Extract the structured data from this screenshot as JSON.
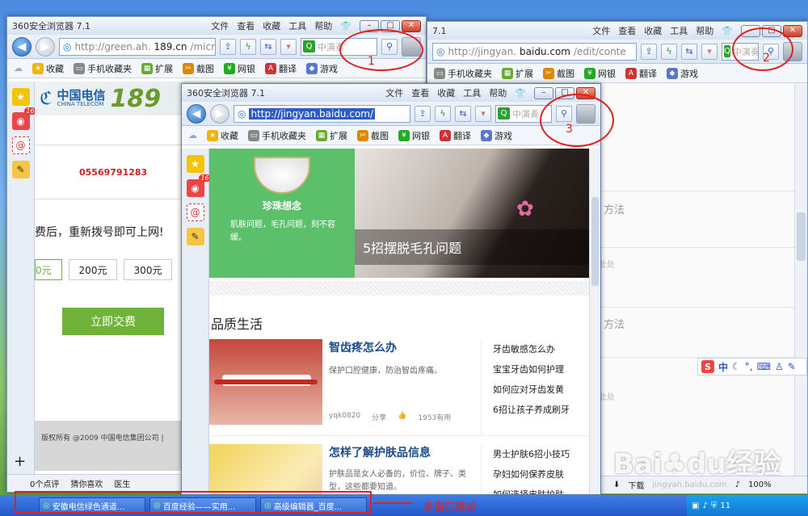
{
  "app_name": "360安全浏览器 7.1",
  "menu": [
    "文件",
    "查看",
    "收藏",
    "工具",
    "帮助"
  ],
  "window_back": {
    "url_prefix": "http://green.ah.",
    "url_domain": "189.cn",
    "url_suffix": "/micro/green",
    "search_placeholder": "中演奏",
    "favorites": [
      "收藏",
      "手机收藏夹",
      "扩展",
      "截图",
      "网银",
      "翻译",
      "游戏"
    ],
    "logo_text": "中国电信",
    "logo_sub": "CHINA TELECOM",
    "logo_number": "189",
    "phone": "05569791283",
    "notice": "费后，重新拨号即可上网!",
    "amounts": [
      "0元",
      "200元",
      "300元"
    ],
    "pay_button": "立即交费",
    "copyright": "版权所有 @2009 中国电信集团公司 |",
    "status": [
      "0个点评",
      "猜你喜欢",
      "医生"
    ]
  },
  "window_right": {
    "url_prefix": "http://jingyan.",
    "url_domain": "baidu.com",
    "url_suffix": "/edit/conte",
    "search_placeholder": "中演奏",
    "favorites": [
      "收藏",
      "手机收藏夹",
      "扩展",
      "截图",
      "网银",
      "翻译",
      "游戏"
    ],
    "rows": [
      "方法",
      "此处",
      "方法",
      "此处"
    ],
    "ime": "中",
    "status_right": "下载",
    "zoom": "100%",
    "watermark": "jingyan.baidu.com"
  },
  "window_front": {
    "url": "http://jingyan.baidu.com/",
    "search_placeholder": "中演奏",
    "favorites": [
      "收藏",
      "手机收藏夹",
      "扩展",
      "截图",
      "网银",
      "翻译",
      "游戏"
    ],
    "banner_name": "珍珠想念",
    "banner_quote": "肌肤问题，毛孔问题，刻不容缓。",
    "banner_title": "5招摆脱毛孔问题",
    "section_title": "品质生活",
    "articles": [
      {
        "title": "智齿疼怎么办",
        "desc": "保护口腔健康，防治智齿疼痛。",
        "user": "yqk0820",
        "share": "分享",
        "useful": "1953有用",
        "links": [
          "牙齿敏感怎么办",
          "宝宝牙齿如何护理",
          "如何应对牙齿发黄",
          "6招让孩子养成刷牙"
        ]
      },
      {
        "title": "怎样了解护肤品信息",
        "desc": "护肤品是女人必备的，价位、牌子、类型，这些都要知道。",
        "links": [
          "男士护肤6招小技巧",
          "孕妇如何保养皮肤",
          "如何选择皮肤护肤"
        ]
      }
    ]
  },
  "annotations": {
    "circle1": "1",
    "circle2": "2",
    "circle3": "3",
    "caption": "多窗口模式"
  },
  "taskbar": [
    "安徽电信绿色通道...",
    "百度经验——实用...",
    "高级编辑器_百度..."
  ],
  "clock": "11",
  "colors": {
    "accent": "#2456c8",
    "telecom": "#1b5fa8",
    "green_button": "#6fb33a",
    "annotation": "#dd2222"
  }
}
